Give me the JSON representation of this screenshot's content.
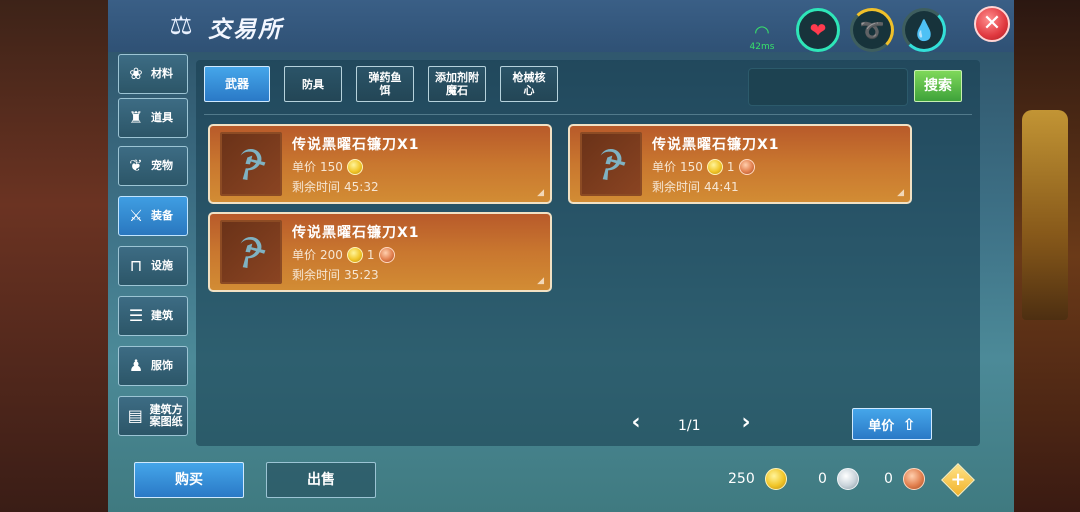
{
  "window": {
    "title": "交易所"
  },
  "status": {
    "ping": "42ms",
    "close_label": "✕"
  },
  "sidebar": {
    "items": [
      {
        "label": "材料",
        "icon": "materials-icon"
      },
      {
        "label": "道具",
        "icon": "tool-icon"
      },
      {
        "label": "宠物",
        "icon": "paw-icon"
      },
      {
        "label": "装备",
        "icon": "equipment-icon"
      },
      {
        "label": "设施",
        "icon": "facility-icon"
      },
      {
        "label": "建筑",
        "icon": "building-icon"
      },
      {
        "label": "服饰",
        "icon": "clothing-icon"
      },
      {
        "label": "建筑方案图纸",
        "icon": "blueprint-icon"
      }
    ],
    "active_index": 3
  },
  "tabs": [
    {
      "label": "武器"
    },
    {
      "label": "防具"
    },
    {
      "label": "弹药鱼饵"
    },
    {
      "label": "添加剂附魔石"
    },
    {
      "label": "枪械核心"
    }
  ],
  "search": {
    "value": "",
    "button_label": "搜索"
  },
  "listings": [
    {
      "name": "传说黑曜石镰刀X1",
      "price_label": "单价",
      "gold": "150",
      "copper": "",
      "time_label": "剩余时间",
      "time_left": "45:32"
    },
    {
      "name": "传说黑曜石镰刀X1",
      "price_label": "单价",
      "gold": "150",
      "copper": "1",
      "time_label": "剩余时间",
      "time_left": "44:41"
    },
    {
      "name": "传说黑曜石镰刀X1",
      "price_label": "单价",
      "gold": "200",
      "copper": "1",
      "time_label": "剩余时间",
      "time_left": "35:23"
    }
  ],
  "pagination": {
    "text": "1/1"
  },
  "sort": {
    "label": "单价"
  },
  "actions": {
    "buy_label": "购买",
    "sell_label": "出售"
  },
  "wallet": {
    "gold": "250",
    "silver": "0",
    "copper": "0"
  }
}
